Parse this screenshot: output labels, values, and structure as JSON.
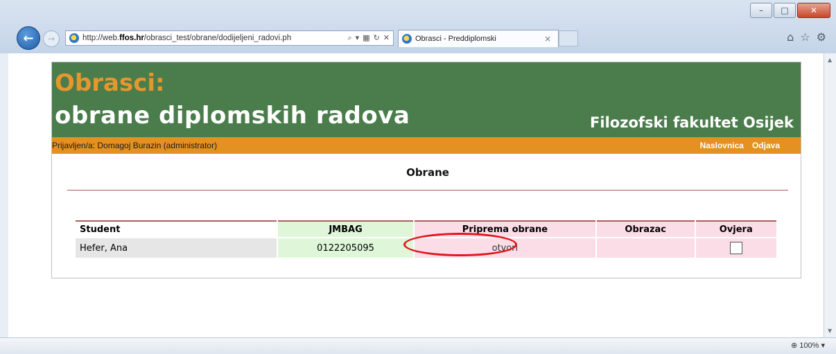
{
  "browser": {
    "url_prefix": "http://web.",
    "url_domain": "ffos.hr",
    "url_path": "/obrasci_test/obrane/dodijeljeni_radovi.ph",
    "tab_title": "Obrasci - Preddiplomski",
    "zoom": "100%"
  },
  "site": {
    "title": "Obrasci:",
    "subtitle": "obrane diplomskih radova",
    "organization": "Filozofski fakultet Osijek",
    "user_info": "Prijavljen/a: Domagoj Burazin (administrator)",
    "links": {
      "home": "Naslovnica",
      "logout": "Odjava"
    },
    "page_heading": "Obrane"
  },
  "table": {
    "headers": [
      "Student",
      "JMBAG",
      "Priprema obrane",
      "Obrazac",
      "Ovjera"
    ],
    "rows": [
      {
        "student": "Hefer, Ana",
        "jmbag": "0122205095",
        "priprema": "otvori",
        "obrazac": "",
        "ovjera_checked": false
      }
    ]
  },
  "colors": {
    "banner": "#4a7d4b",
    "accent_orange": "#e39120",
    "annotation_red": "#e0161b"
  }
}
